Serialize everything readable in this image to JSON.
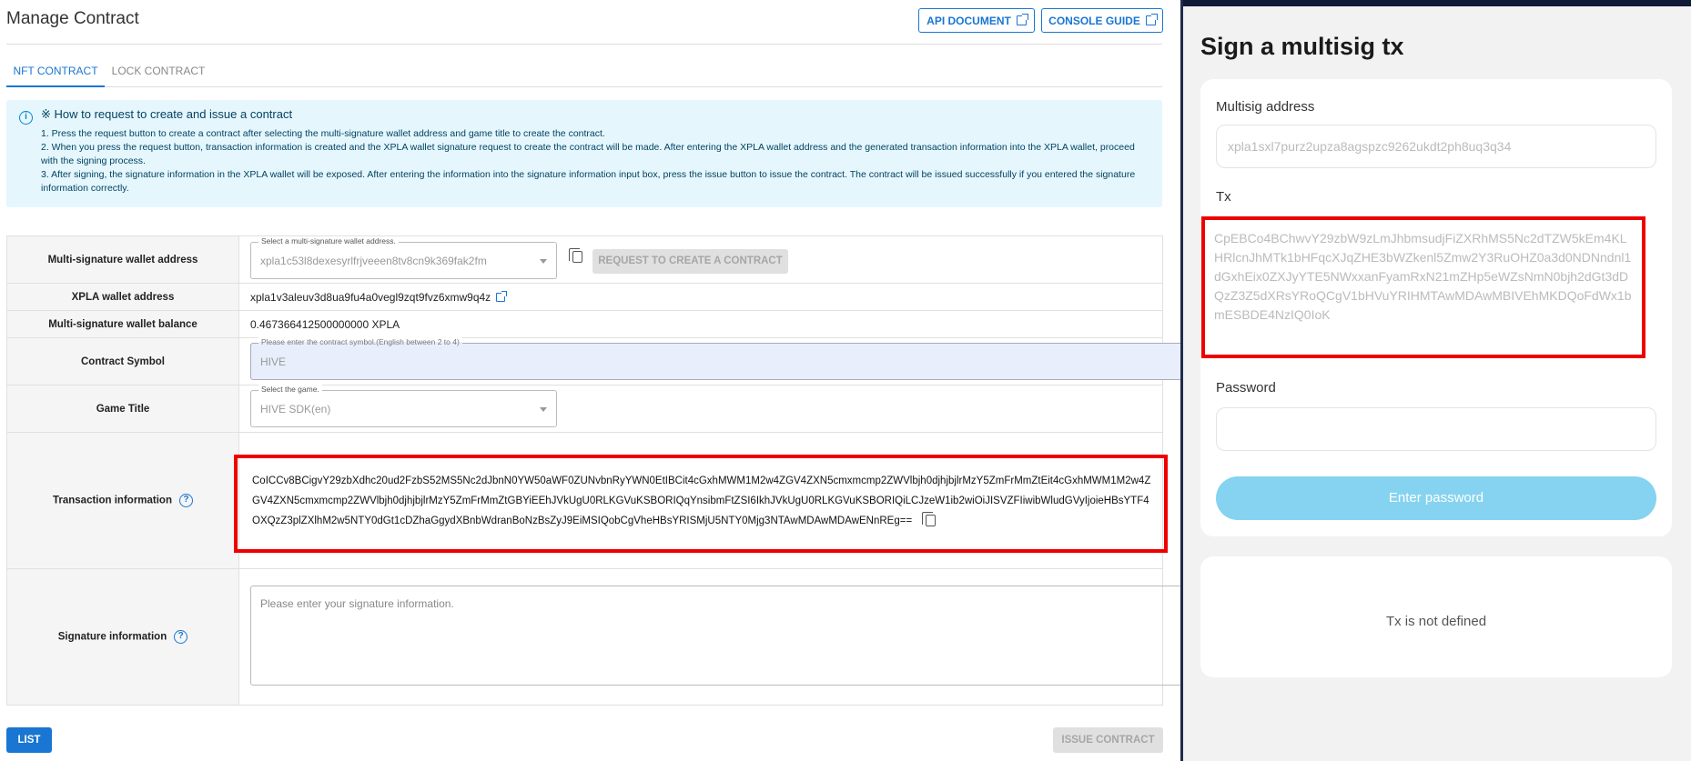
{
  "page": {
    "title": "Manage Contract",
    "api_document": "API DOCUMENT",
    "console_guide": "CONSOLE GUIDE"
  },
  "tabs": [
    {
      "label": "NFT CONTRACT",
      "active": true
    },
    {
      "label": "LOCK CONTRACT",
      "active": false
    }
  ],
  "info": {
    "title": "※ How to request to create and issue a contract",
    "lines": [
      "1. Press the request button to create a contract after selecting the multi-signature wallet address and game title to create the contract.",
      "2. When you press the request button, transaction information is created and the XPLA wallet signature request to create the contract will be made. After entering the XPLA wallet address and the generated transaction information into the XPLA wallet, proceed with the signing process.",
      "3. After signing, the signature information in the XPLA wallet will be exposed. After entering the information into the signature information input box, press the issue button to issue the contract. The contract will be issued successfully if you entered the signature information correctly."
    ]
  },
  "form": {
    "multisig_label": "Multi-signature wallet address",
    "multisig_legend": "Select a multi-signature wallet address.",
    "multisig_value": "xpla1c53l8dexesyrlfrjveeen8tv8cn9k369fak2fm",
    "request_button": "REQUEST TO CREATE A CONTRACT",
    "xpla_label": "XPLA wallet address",
    "xpla_value": "xpla1v3aleuv3d8ua9fu4a0vegl9zqt9fvz6xmw9q4z",
    "balance_label": "Multi-signature wallet balance",
    "balance_value": "0.467366412500000000 XPLA",
    "symbol_label": "Contract Symbol",
    "symbol_legend": "Please enter the contract symbol.(English between 2 to 4)",
    "symbol_value": "HIVE",
    "game_label": "Game Title",
    "game_legend": "Select the game.",
    "game_value": "HIVE SDK(en)",
    "tx_label": "Transaction information",
    "tx_value": "CoICCv8BCigvY29zbXdhc20ud2FzbS52MS5Nc2dJbnN0YW50aWF0ZUNvbnRyYWN0EtIBCit4cGxhMWM1M2w4ZGV4ZXN5cmxmcmp2ZWVlbjh0djhjbjlrMzY5ZmFrMmZtEit4cGxhMWM1M2w4ZGV4ZXN5cmxmcmp2ZWVlbjh0djhjbjlrMzY5ZmFrMmZtGBYiEEhJVkUgU0RLKGVuKSBORIQqYnsibmFtZSI6IkhJVkUgU0RLKGVuKSBORIQiLCJzeW1ib2wiOiJISVZFIiwibWludGVyIjoieHBsYTF4OXQzZ3plZXlhM2w5NTY0dGt1cDZhaGgydXBnbWdranBoNzBsZyJ9EiMSIQobCgVheHBsYRISMjU5NTY0Mjg3NTAwMDAwMDAwENnREg==",
    "sig_label": "Signature information",
    "sig_placeholder": "Please enter your signature information."
  },
  "footer": {
    "list_button": "LIST",
    "issue_button": "ISSUE CONTRACT"
  },
  "wallet": {
    "title": "Sign a multisig tx",
    "multisig_label": "Multisig address",
    "multisig_value": "xpla1sxl7purz2upza8agspzc9262ukdt2ph8uq3q34",
    "tx_label": "Tx",
    "tx_value": "CpEBCo4BChwvY29zbW9zLmJhbmsudjFiZXRhMS5Nc2dTZW5kEm4KLHRlcnJhMTk1bHFqcXJqZHE3bWZkenl5Zmw2Y3RuOHZ0a3d0NDNndnl1dGxhEix0ZXJyYTE5NWxxanFyamRxN21mZHp5eWZsNmN0bjh2dGt3dDQzZ3Z5dXRsYRoQCgV1bHVuYRIHMTAwMDAwMBIVEhMKDQoFdWx1bmESBDE4NzIQ0IoK",
    "password_label": "Password",
    "enter_button": "Enter password",
    "status": "Tx is not defined"
  },
  "colors": {
    "primary": "#1976d2",
    "highlight": "#ee0000",
    "info_bg": "#e5f6fd",
    "wallet_button": "#85d3f0",
    "wallet_bg": "#f2f2f2",
    "divider": "#1f2d4d"
  }
}
